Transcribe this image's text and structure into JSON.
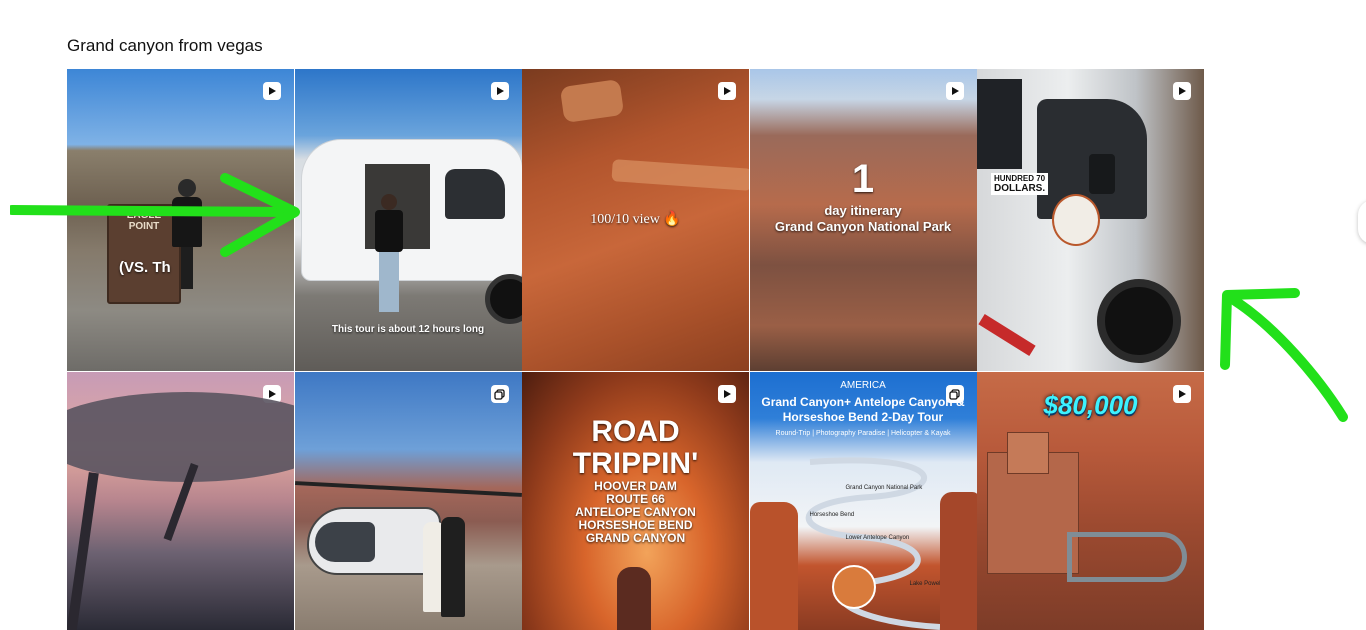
{
  "board": {
    "title": "Grand canyon from vegas"
  },
  "tiles": [
    {
      "overlay": "(VS. Th",
      "sign": "EAGLE POINT",
      "badge": "video"
    },
    {
      "overlay": "This tour is about 12 hours long",
      "badge": "video"
    },
    {
      "overlay": "100/10 view 🔥",
      "badge": "video"
    },
    {
      "overlay_big": "1",
      "overlay_mid": "day itinerary",
      "overlay_small": "Grand Canyon National Park",
      "badge": "video"
    },
    {
      "overlay_top": "HUNDRED 70",
      "overlay_bottom": "DOLLARS.",
      "badge": "video"
    },
    {
      "badge": "video"
    },
    {
      "badge": "gallery"
    },
    {
      "headline": "ROAD TRIPPIN'",
      "lines": [
        "HOOVER DAM",
        "ROUTE 66",
        "ANTELOPE CANYON",
        "HORSESHOE BEND",
        "GRAND CANYON"
      ],
      "badge": "video"
    },
    {
      "kicker": "AMERICA",
      "headline": "Grand Canyon+ Antelope Canyon & Horseshoe Bend 2-Day Tour",
      "sub": "Round-Trip | Photography Paradise | Helicopter & Kayak",
      "stops": [
        "Grand Canyon National Park",
        "Horseshoe Bend",
        "Lower Antelope Canyon",
        "Lake Powell"
      ],
      "badge": "gallery"
    },
    {
      "headline": "$80,000",
      "badge": "video"
    }
  ],
  "annotation_color": "#22e01a"
}
